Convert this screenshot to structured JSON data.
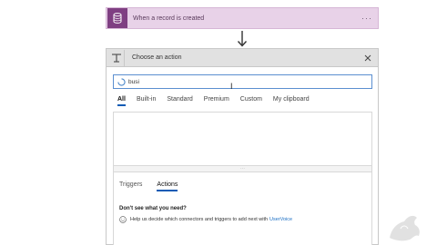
{
  "trigger": {
    "title": "When a record is created",
    "more_label": "···"
  },
  "action": {
    "title": "Choose an action",
    "search": {
      "value": "busi"
    },
    "tabs": [
      {
        "label": "All",
        "active": true
      },
      {
        "label": "Built-in",
        "active": false
      },
      {
        "label": "Standard",
        "active": false
      },
      {
        "label": "Premium",
        "active": false
      },
      {
        "label": "Custom",
        "active": false
      },
      {
        "label": "My clipboard",
        "active": false
      }
    ],
    "sub_tabs": [
      {
        "label": "Triggers",
        "active": false
      },
      {
        "label": "Actions",
        "active": true
      }
    ],
    "help": {
      "heading": "Don't see what you need?",
      "text": "Help us decide which connectors and triggers to add next with",
      "link": "UserVoice"
    }
  },
  "colors": {
    "trigger_bg": "#e8d2e8",
    "trigger_icon": "#7f3f82",
    "accent": "#0f5bb5",
    "link": "#1a6ec4"
  }
}
